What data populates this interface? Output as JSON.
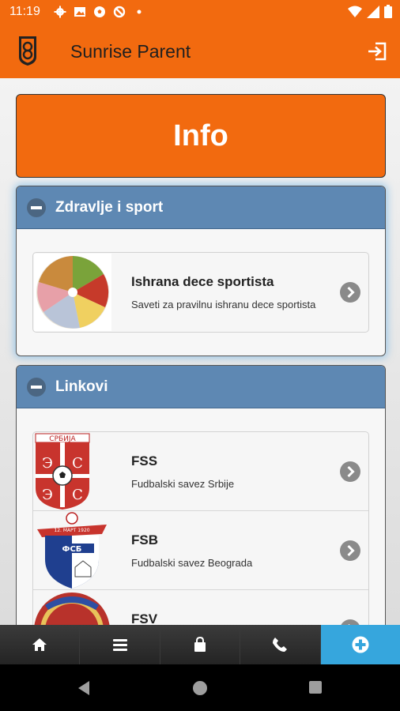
{
  "status_bar": {
    "time": "11:19",
    "icons": [
      "gear-icon",
      "image-icon",
      "soccer-ball-icon",
      "blocked-icon",
      "dot-icon"
    ],
    "right_icons": [
      "wifi-icon",
      "signal-icon",
      "battery-icon"
    ]
  },
  "app_bar": {
    "title": "Sunrise Parent",
    "logo": "club-logo",
    "action_icon": "logout-icon"
  },
  "info_button": {
    "label": "Info"
  },
  "sections": [
    {
      "title": "Zdravlje i sport",
      "items": [
        {
          "title": "Ishrana dece sportista",
          "subtitle": "Saveti za pravilnu ishranu dece sportista",
          "thumb": "food-plate-image"
        }
      ]
    },
    {
      "title": "Linkovi",
      "items": [
        {
          "title": "FSS",
          "subtitle": "Fudbalski savez Srbije",
          "thumb": "fss-crest-image",
          "crest_text": "СРБИЈА"
        },
        {
          "title": "FSB",
          "subtitle": "Fudbalski savez Beograda",
          "thumb": "fsb-crest-image",
          "crest_text": "ФСБ",
          "crest_date": "12. МАРТ 1920"
        },
        {
          "title": "FSV",
          "subtitle": "",
          "thumb": "fsv-crest-image"
        }
      ]
    }
  ],
  "tab_bar": {
    "tabs": [
      {
        "icon": "home-icon",
        "active": false
      },
      {
        "icon": "menu-icon",
        "active": false
      },
      {
        "icon": "shopping-bag-icon",
        "active": false
      },
      {
        "icon": "phone-icon",
        "active": false
      },
      {
        "icon": "plus-icon",
        "active": true
      }
    ]
  },
  "nav_bar": {
    "icons": [
      "back-icon",
      "home-circle-icon",
      "recents-icon"
    ]
  },
  "colors": {
    "primary": "#f26a0f",
    "section_header": "#5e88b3",
    "active_tab": "#36a6dd"
  }
}
